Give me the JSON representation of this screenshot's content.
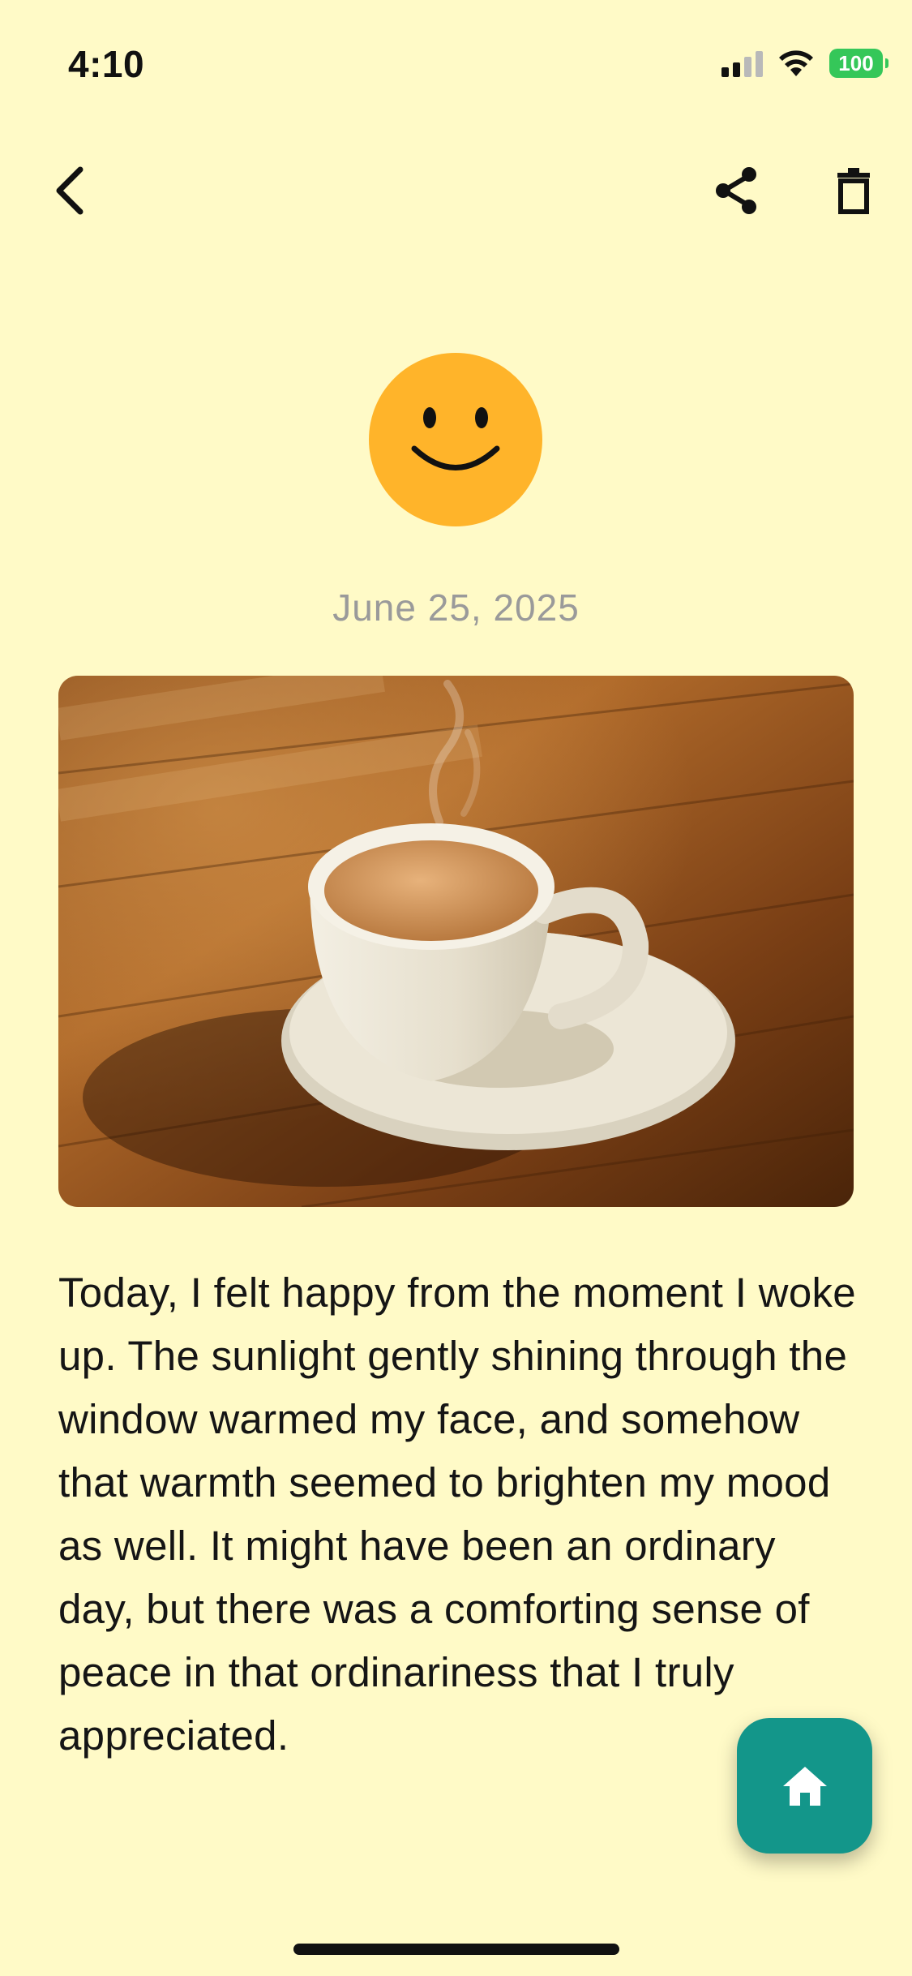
{
  "status_bar": {
    "time": "4:10",
    "battery_level": "100",
    "signal_icon": "cellular-signal-icon",
    "wifi_icon": "wifi-icon",
    "battery_color": "#35C759"
  },
  "toolbar": {
    "back_icon": "chevron-left-icon",
    "share_icon": "share-icon",
    "delete_icon": "trash-icon"
  },
  "entry": {
    "mood_icon": "smiley-face-icon",
    "mood_color": "#FFB42A",
    "date": "June 25, 2025",
    "photo_subject": "coffee-cup-on-wooden-table",
    "text": "Today, I felt happy from the moment I woke up. The sunlight gently shining through the window warmed my face, and somehow that warmth seemed to brighten my mood as well. It might have been an ordinary day, but there was a comforting sense of peace in that ordinariness that I truly appreciated."
  },
  "fab": {
    "icon": "home-icon",
    "color": "#13968A"
  },
  "theme": {
    "background": "#FFFAC7"
  }
}
